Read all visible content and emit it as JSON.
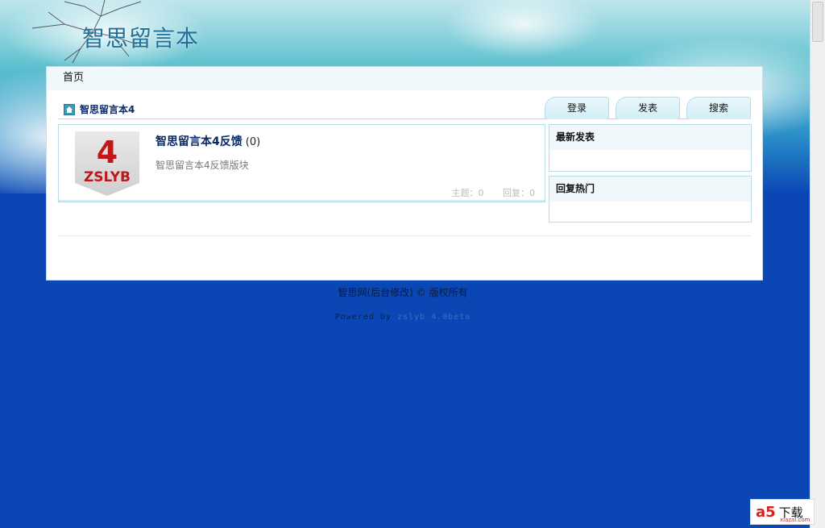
{
  "header": {
    "site_title": "智思留言本"
  },
  "topnav": {
    "home": "首页"
  },
  "breadcrumb": {
    "label": "智思留言本4"
  },
  "tabs": [
    {
      "label": "登录"
    },
    {
      "label": "发表"
    },
    {
      "label": "搜索"
    }
  ],
  "forum": {
    "badge_number": "4",
    "badge_text": "ZSLYB",
    "title": "智思留言本4反馈",
    "count": "(0)",
    "description": "智思留言本4反馈版块",
    "topics": "主题：0",
    "replies": "回复：0"
  },
  "sidebar": {
    "latest": "最新发表",
    "hot": "回复热门"
  },
  "footer": {
    "copyright": "智思网(后台修改) © 版权所有",
    "powered_prefix": "Powered by",
    "powered_brand": "zslyb 4.0beta"
  },
  "watermark": {
    "logo": "a5",
    "text": "下载",
    "sub": "xiazai.com"
  }
}
